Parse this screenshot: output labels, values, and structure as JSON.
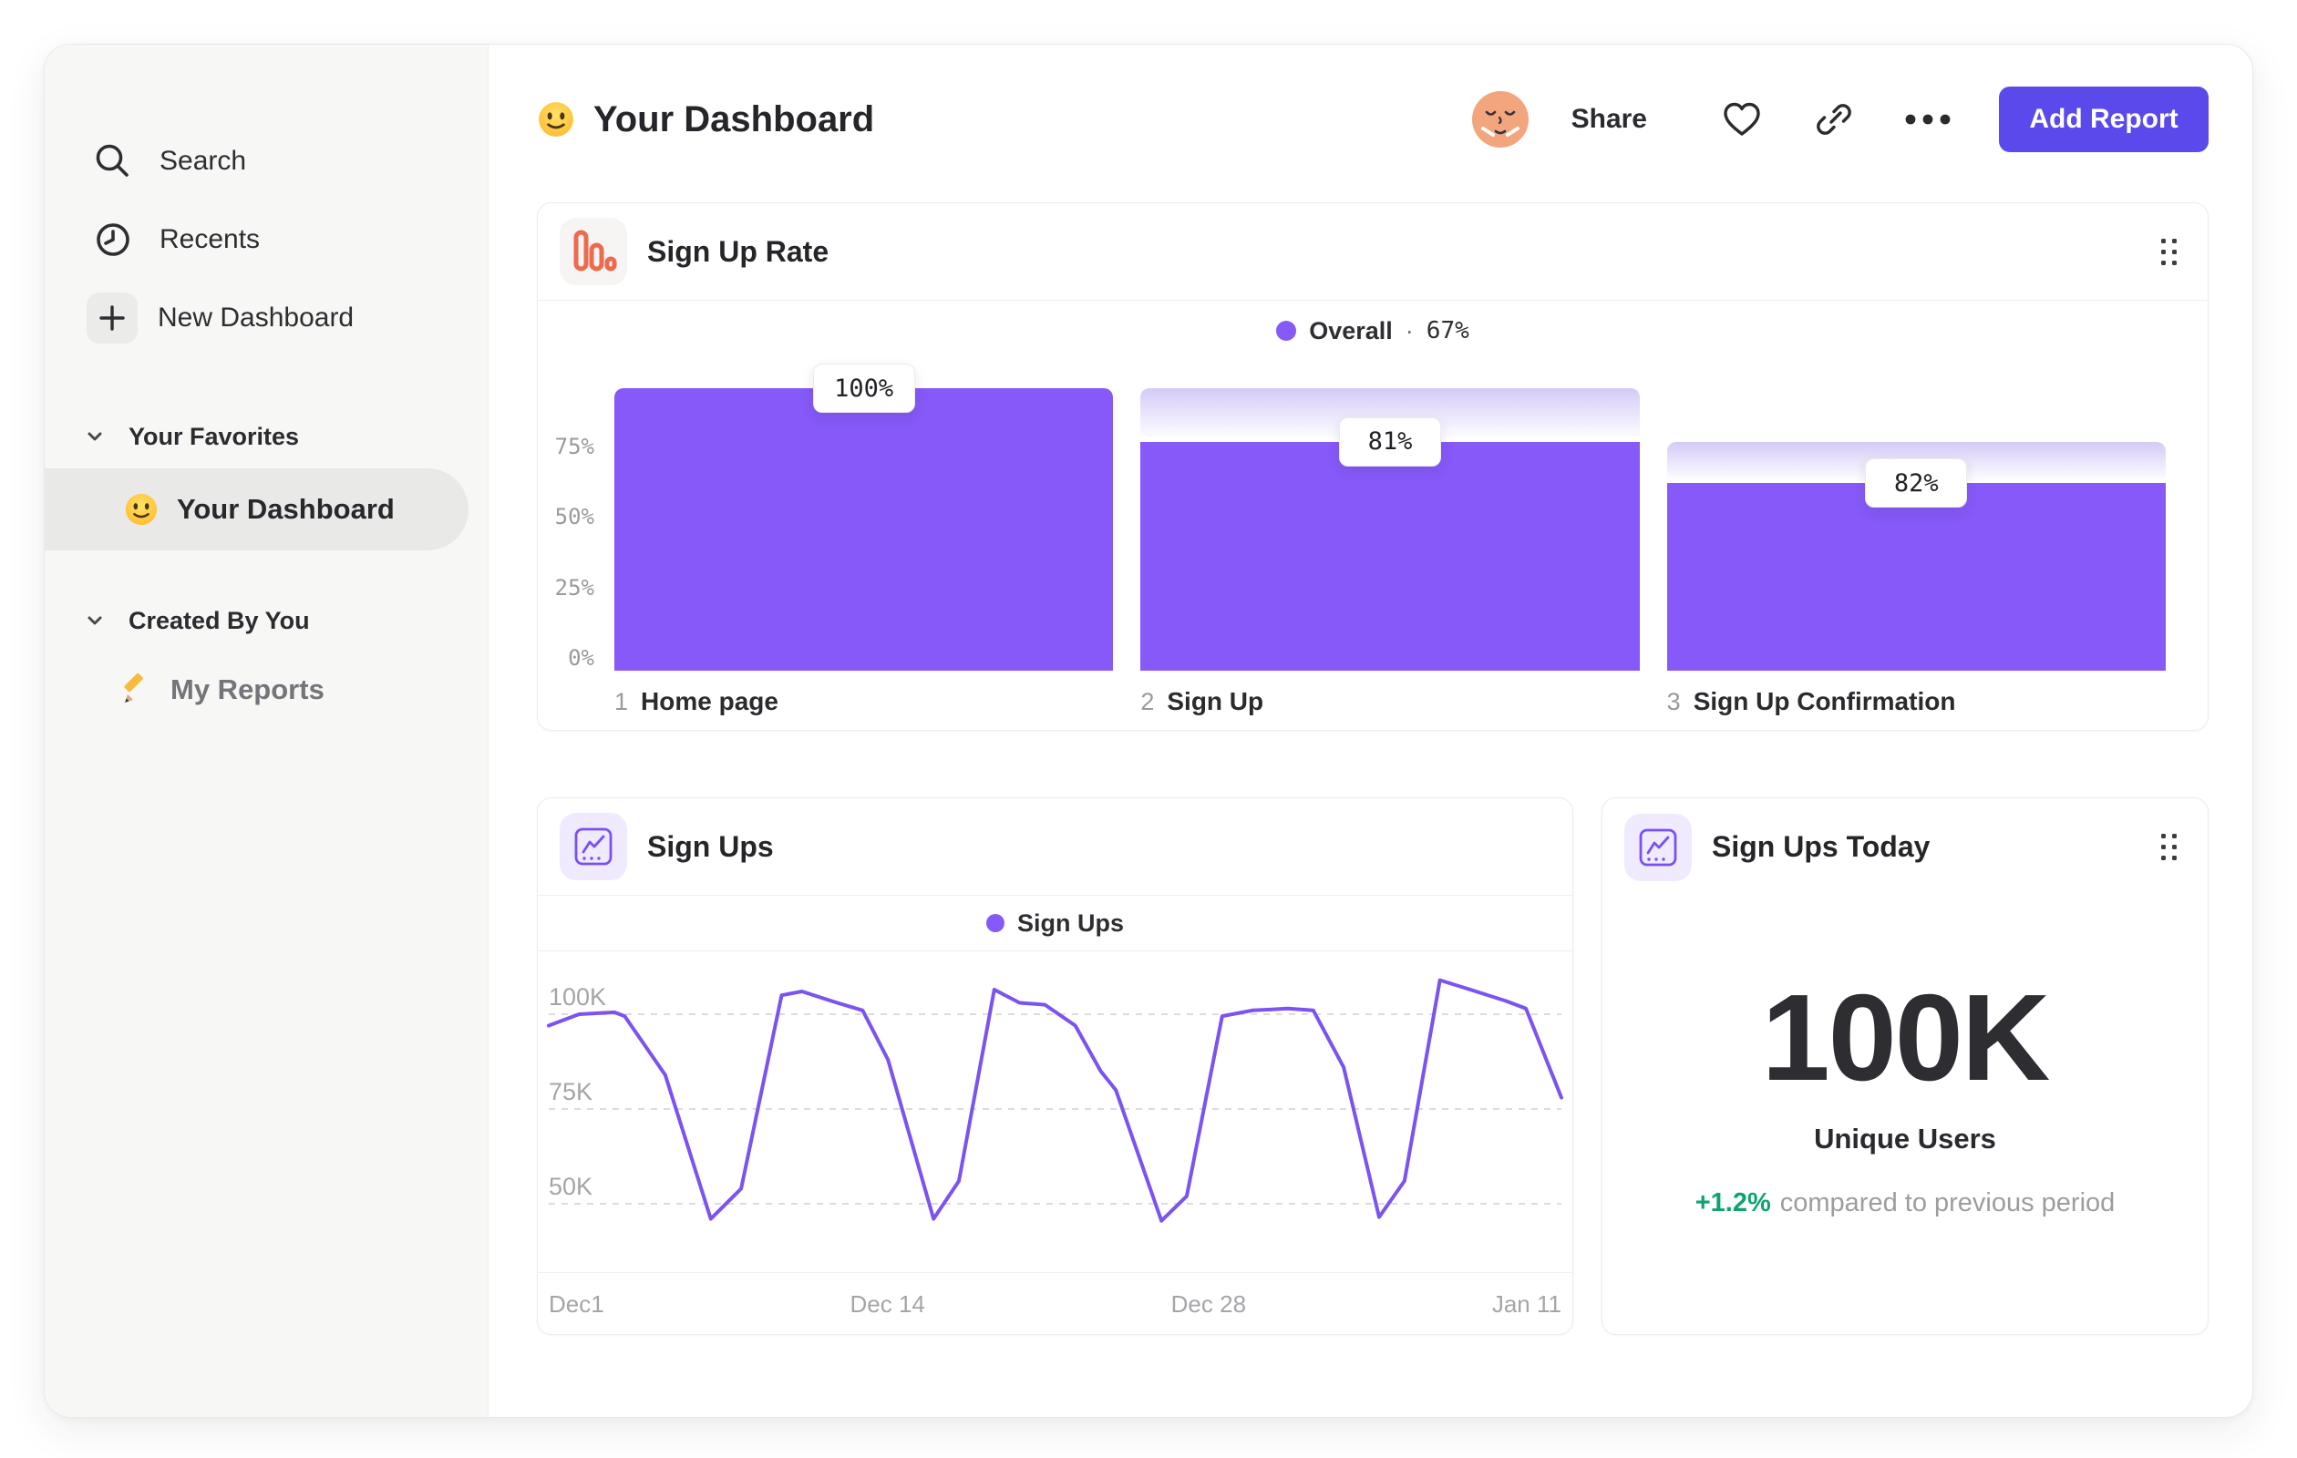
{
  "sidebar": {
    "items": [
      {
        "label": "Search"
      },
      {
        "label": "Recents"
      },
      {
        "label": "New Dashboard"
      }
    ],
    "sections": [
      {
        "title": "Your Favorites",
        "item": {
          "label": "Your Dashboard"
        }
      },
      {
        "title": "Created By You",
        "item": {
          "label": "My Reports"
        }
      }
    ]
  },
  "header": {
    "title": "Your Dashboard",
    "share_label": "Share",
    "add_report_label": "Add Report"
  },
  "funnel_card": {
    "title": "Sign Up Rate",
    "legend_name": "Overall",
    "legend_sep": "·",
    "legend_value": "67%"
  },
  "line_card": {
    "title": "Sign Ups",
    "legend_name": "Sign Ups"
  },
  "today_card": {
    "title": "Sign Ups Today",
    "value": "100K",
    "label": "Unique Users",
    "delta": "+1.2%",
    "delta_text": "compared to previous period"
  },
  "colors": {
    "accent_purple": "#8659f8",
    "line_purple": "#7b53f0",
    "button_purple": "#5a4aec",
    "green": "#0ca36d",
    "funnel_icon_orange": "#ee6a4e"
  },
  "chart_data": [
    {
      "type": "bar",
      "subtype": "funnel",
      "title": "Sign Up Rate",
      "legend": "Overall · 67%",
      "ylim": [
        0,
        100
      ],
      "y_ticks": [
        {
          "label": "75%",
          "value": 75
        },
        {
          "label": "50%",
          "value": 50
        },
        {
          "label": "25%",
          "value": 25
        },
        {
          "label": "0%",
          "value": 0
        }
      ],
      "steps": [
        {
          "num": "1",
          "name": "Home page",
          "tooltip": "100%",
          "step_conversion_pct": 100,
          "cumulative_pct": 100,
          "prev_cumulative_pct": 100
        },
        {
          "num": "2",
          "name": "Sign Up",
          "tooltip": "81%",
          "step_conversion_pct": 81,
          "cumulative_pct": 81,
          "prev_cumulative_pct": 100
        },
        {
          "num": "3",
          "name": "Sign Up Confirmation",
          "tooltip": "82%",
          "step_conversion_pct": 82,
          "cumulative_pct": 66.4,
          "prev_cumulative_pct": 81
        }
      ],
      "overall_conversion_pct": 67
    },
    {
      "type": "line",
      "title": "Sign Ups",
      "series_name": "Sign Ups",
      "unit": "K",
      "y_ticks": [
        {
          "label": "100K",
          "value": 100
        },
        {
          "label": "75K",
          "value": 75
        },
        {
          "label": "50K",
          "value": 50
        }
      ],
      "x_labels": [
        "Dec1",
        "Dec 14",
        "Dec 28",
        "Jan 11"
      ],
      "points": [
        [
          0.0,
          97
        ],
        [
          0.03,
          100
        ],
        [
          0.065,
          100.5
        ],
        [
          0.075,
          99.5
        ],
        [
          0.115,
          84
        ],
        [
          0.16,
          46
        ],
        [
          0.19,
          54
        ],
        [
          0.23,
          105
        ],
        [
          0.25,
          106
        ],
        [
          0.285,
          103
        ],
        [
          0.31,
          101
        ],
        [
          0.335,
          88
        ],
        [
          0.38,
          46
        ],
        [
          0.405,
          56
        ],
        [
          0.44,
          106.5
        ],
        [
          0.465,
          103
        ],
        [
          0.49,
          102.5
        ],
        [
          0.52,
          97
        ],
        [
          0.545,
          85
        ],
        [
          0.56,
          80
        ],
        [
          0.605,
          45.5
        ],
        [
          0.63,
          52
        ],
        [
          0.665,
          99.5
        ],
        [
          0.695,
          101
        ],
        [
          0.73,
          101.5
        ],
        [
          0.755,
          101
        ],
        [
          0.785,
          86
        ],
        [
          0.82,
          46.5
        ],
        [
          0.845,
          56
        ],
        [
          0.88,
          109
        ],
        [
          0.91,
          106.5
        ],
        [
          0.945,
          103.5
        ],
        [
          0.965,
          101.5
        ],
        [
          1.0,
          78
        ]
      ]
    },
    {
      "type": "metric",
      "title": "Sign Ups Today",
      "value": "100K",
      "label": "Unique Users",
      "delta_pct": "+1.2%",
      "comparison": "compared to previous period"
    }
  ]
}
